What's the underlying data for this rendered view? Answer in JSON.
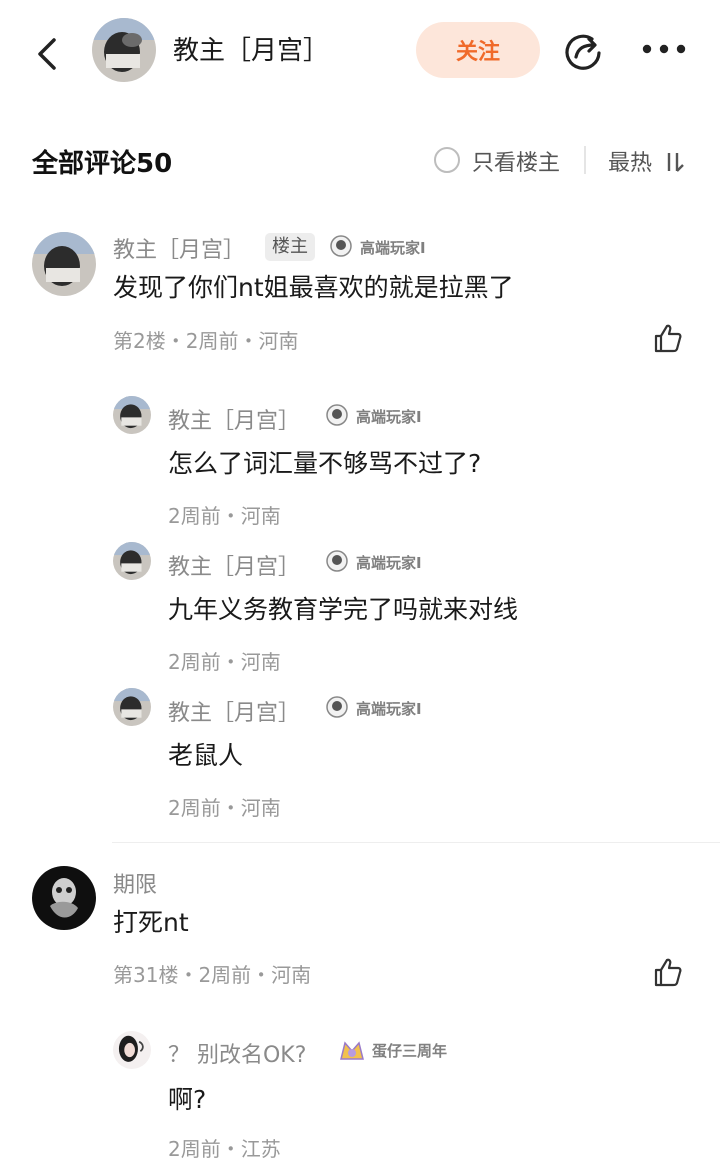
{
  "header": {
    "username": "教主［月宫］",
    "follow_label": "关注",
    "icons": [
      "back-icon",
      "avatar",
      "share-icon",
      "more-icon"
    ]
  },
  "comments_bar": {
    "title": "全部评论50",
    "only_op_label": "只看楼主",
    "sort_label": "最热",
    "sort_icon": "sort-icon"
  },
  "comments": [
    {
      "username": "教主［月宫］",
      "op_badge": "楼主",
      "medal": "高端玩家I",
      "content": "发现了你们nt姐最喜欢的就是拉黑了",
      "meta": "第2楼・2周前・河南",
      "replies": [
        {
          "username": "教主［月宫］",
          "medal": "高端玩家I",
          "content": "怎么了词汇量不够骂不过了?",
          "meta": "2周前・河南"
        },
        {
          "username": "教主［月宫］",
          "medal": "高端玩家I",
          "content": "九年义务教育学完了吗就来对线",
          "meta": "2周前・河南"
        },
        {
          "username": "教主［月宫］",
          "medal": "高端玩家I",
          "content": "老鼠人",
          "meta": "2周前・河南"
        }
      ]
    },
    {
      "username": "期限",
      "content": "打死nt",
      "meta": "第31楼・2周前・河南",
      "replies": [
        {
          "username": "？ 别改名OK?",
          "medal": "蛋仔三周年",
          "content": "啊?",
          "meta": "2周前・江苏"
        }
      ]
    }
  ],
  "colors": {
    "accent": "#f06a2a",
    "follow_bg": "#fde6da",
    "secondary_text": "#8a8a8a",
    "meta_text": "#999999"
  }
}
